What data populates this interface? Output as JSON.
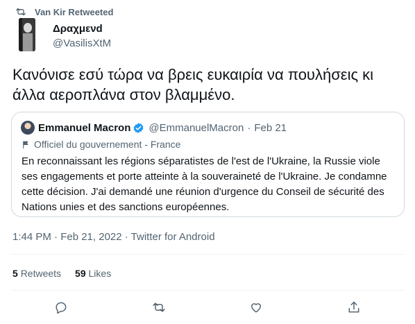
{
  "retweet_header": {
    "icon": "retweet-icon",
    "label": "Van Kir Retweeted"
  },
  "author": {
    "display_name": "Δραχμενd",
    "handle": "@VasilisXtM"
  },
  "tweet": {
    "text": "Κανόνισε εσύ τώρα να βρεις ευκαιρία να πουλήσεις κι άλλα αεροπλάνα στον βλαμμένο."
  },
  "quoted": {
    "display_name": "Emmanuel Macron",
    "verified_icon": "verified-badge-icon",
    "handle": "@EmmanuelMacron",
    "separator": "·",
    "date": "Feb 21",
    "official_label": "Officiel du gouvernement - France",
    "text": "En reconnaissant les régions séparatistes de l'est de l'Ukraine, la Russie viole ses engagements et porte atteinte à la souveraineté de l'Ukraine. Je condamne cette décision. J'ai demandé une réunion d'urgence du Conseil de sécurité des Nations unies et des sanctions européennes."
  },
  "meta": {
    "timestamp": "1:44 PM · Feb 21, 2022 · Twitter for Android"
  },
  "stats": {
    "retweets_count": "5",
    "retweets_label": "Retweets",
    "likes_count": "59",
    "likes_label": "Likes"
  },
  "actions": [
    "reply-icon",
    "retweet-icon",
    "like-icon",
    "share-icon"
  ],
  "colors": {
    "text": "#0f1419",
    "secondary": "#536471",
    "border": "#cfd9de",
    "verified": "#1d9bf0"
  }
}
